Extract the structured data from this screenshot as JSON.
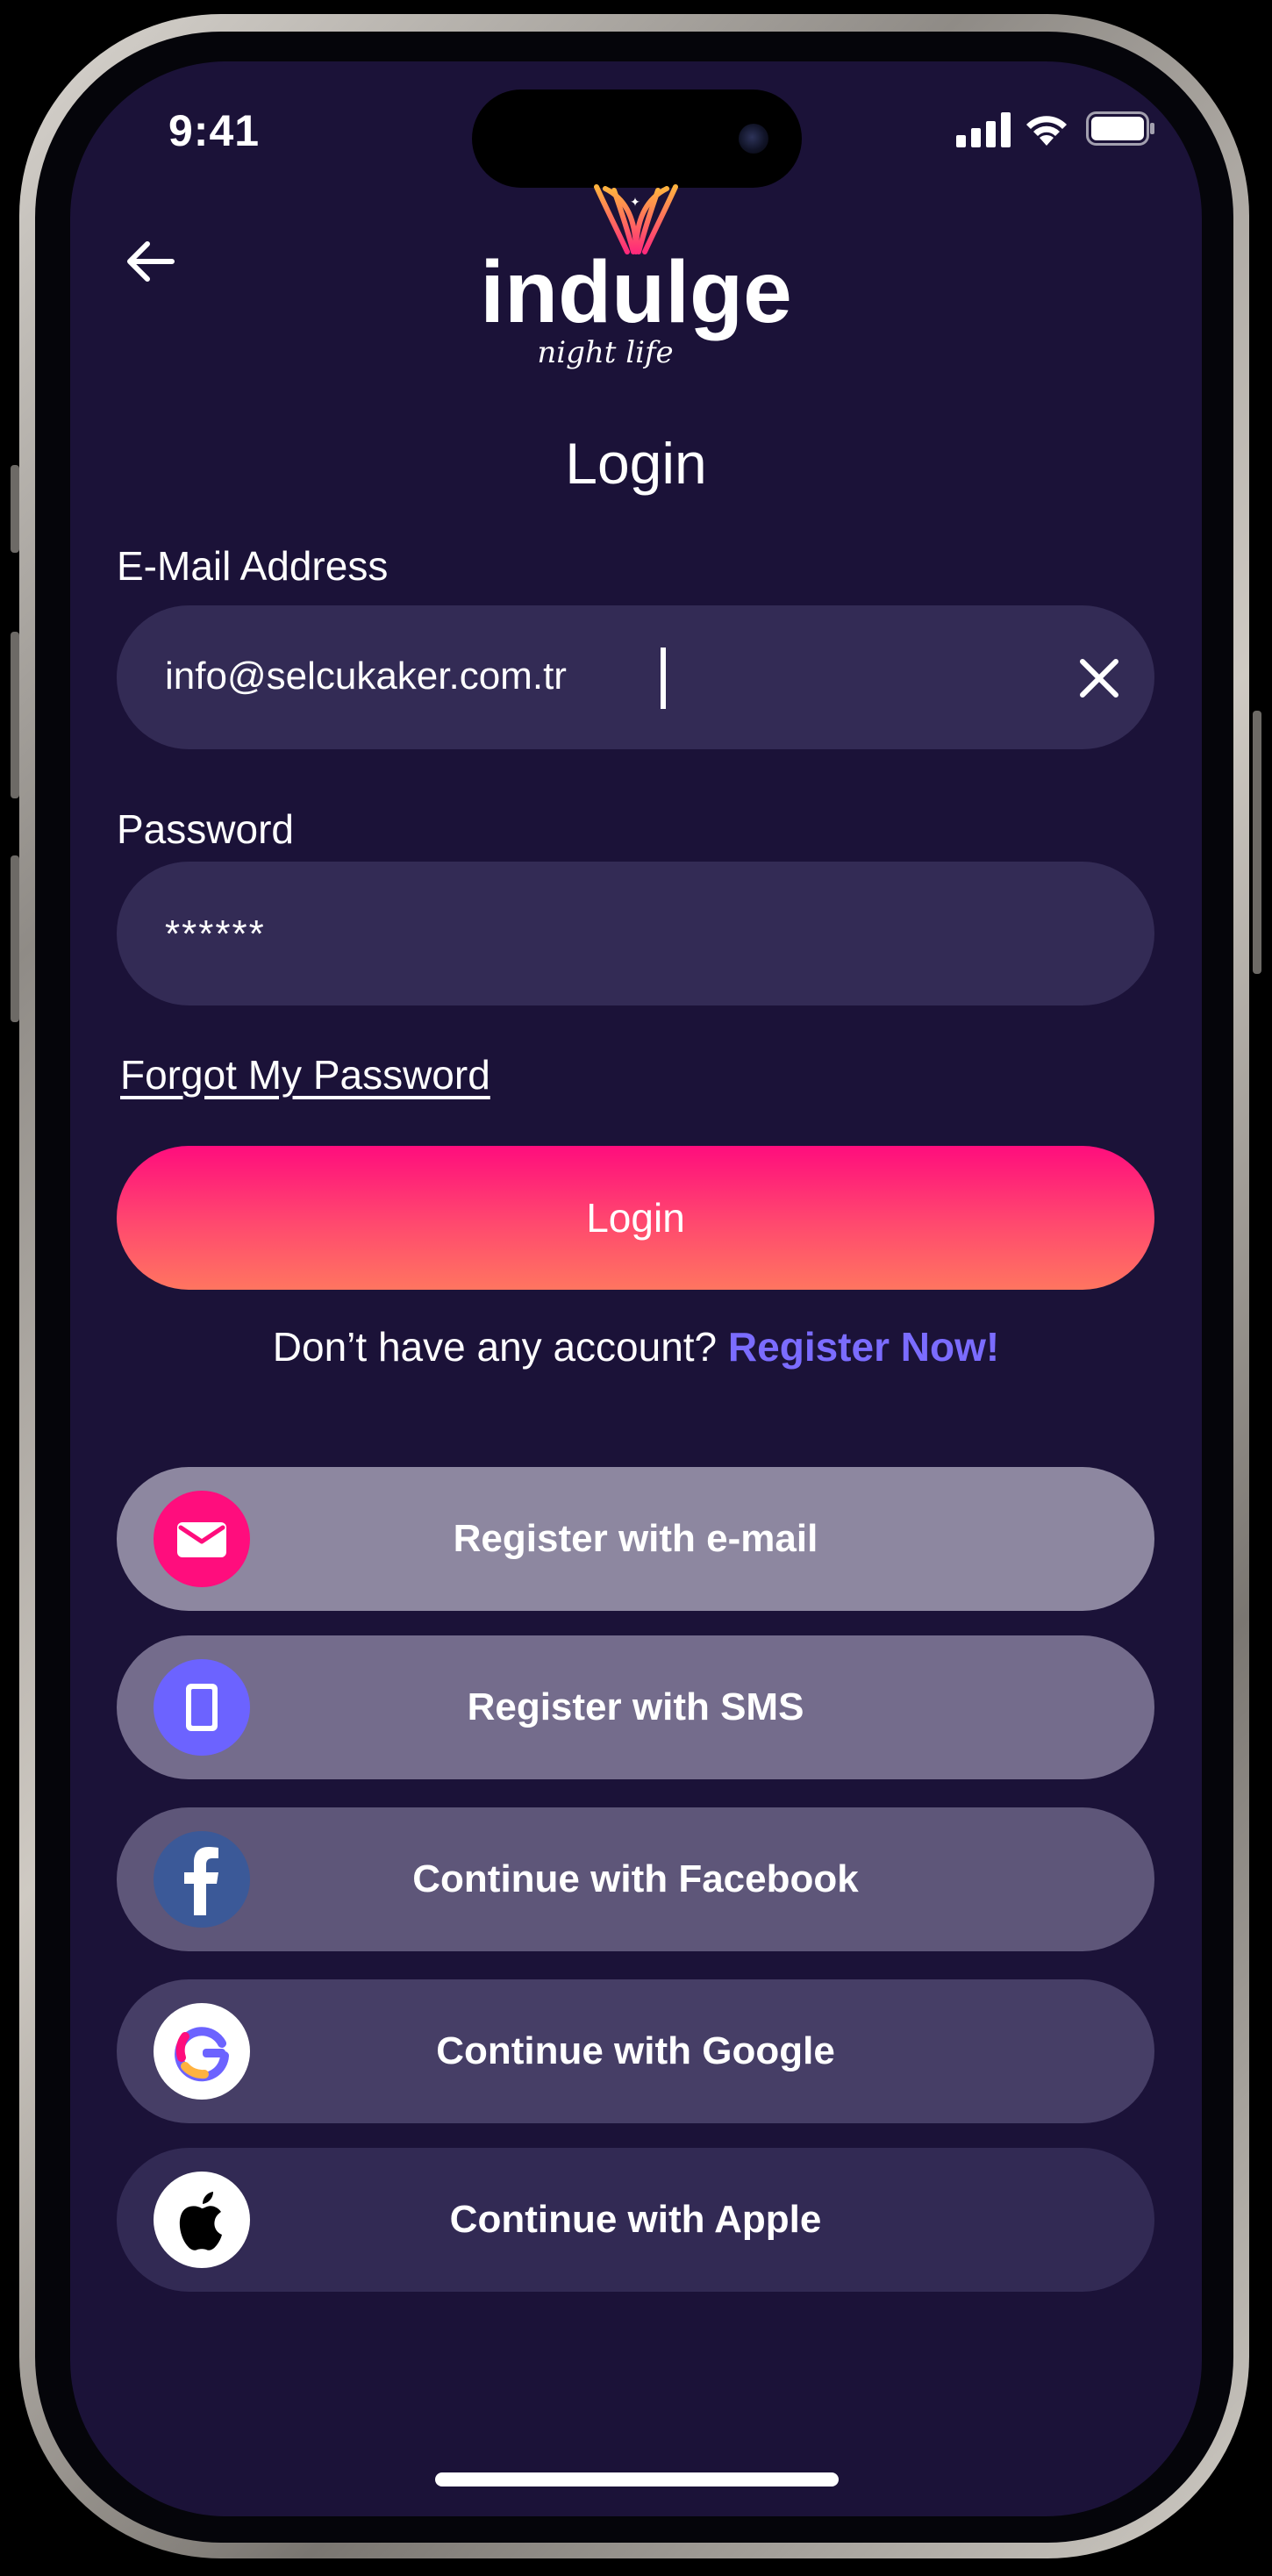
{
  "status_bar": {
    "time": "9:41"
  },
  "header": {
    "logo_wordmark": "indulge",
    "logo_tagline": "night life",
    "title": "Login"
  },
  "form": {
    "email_label": "E-Mail Address",
    "email_value": "info@selcukaker.com.tr",
    "password_label": "Password",
    "password_value": "******",
    "forgot_link": "Forgot My Password",
    "login_button": "Login"
  },
  "register_prompt": {
    "text": "Don’t have any account?",
    "link": "Register Now!"
  },
  "social_buttons": [
    {
      "label": "Register with e-mail",
      "icon": "mail-icon",
      "bg": "#8d87a0",
      "icon_bg": "#ff0d7d"
    },
    {
      "label": "Register with SMS",
      "icon": "mobile-phone-icon",
      "bg": "#746c8c",
      "icon_bg": "#6c63ff"
    },
    {
      "label": "Continue with Facebook",
      "icon": "facebook-icon",
      "bg": "#5e5679",
      "icon_bg": "#3b5998"
    },
    {
      "label": "Continue with Google",
      "icon": "google-icon",
      "bg": "#463e66",
      "icon_bg": "#ffffff"
    },
    {
      "label": "Continue with Apple",
      "icon": "apple-icon",
      "bg": "#322a54",
      "icon_bg": "#ffffff"
    }
  ],
  "colors": {
    "background": "#1b1238",
    "field": "#332b55",
    "accent_pink": "#ff0d7d",
    "accent_coral": "#ff7560",
    "link_purple": "#7b6cff"
  }
}
